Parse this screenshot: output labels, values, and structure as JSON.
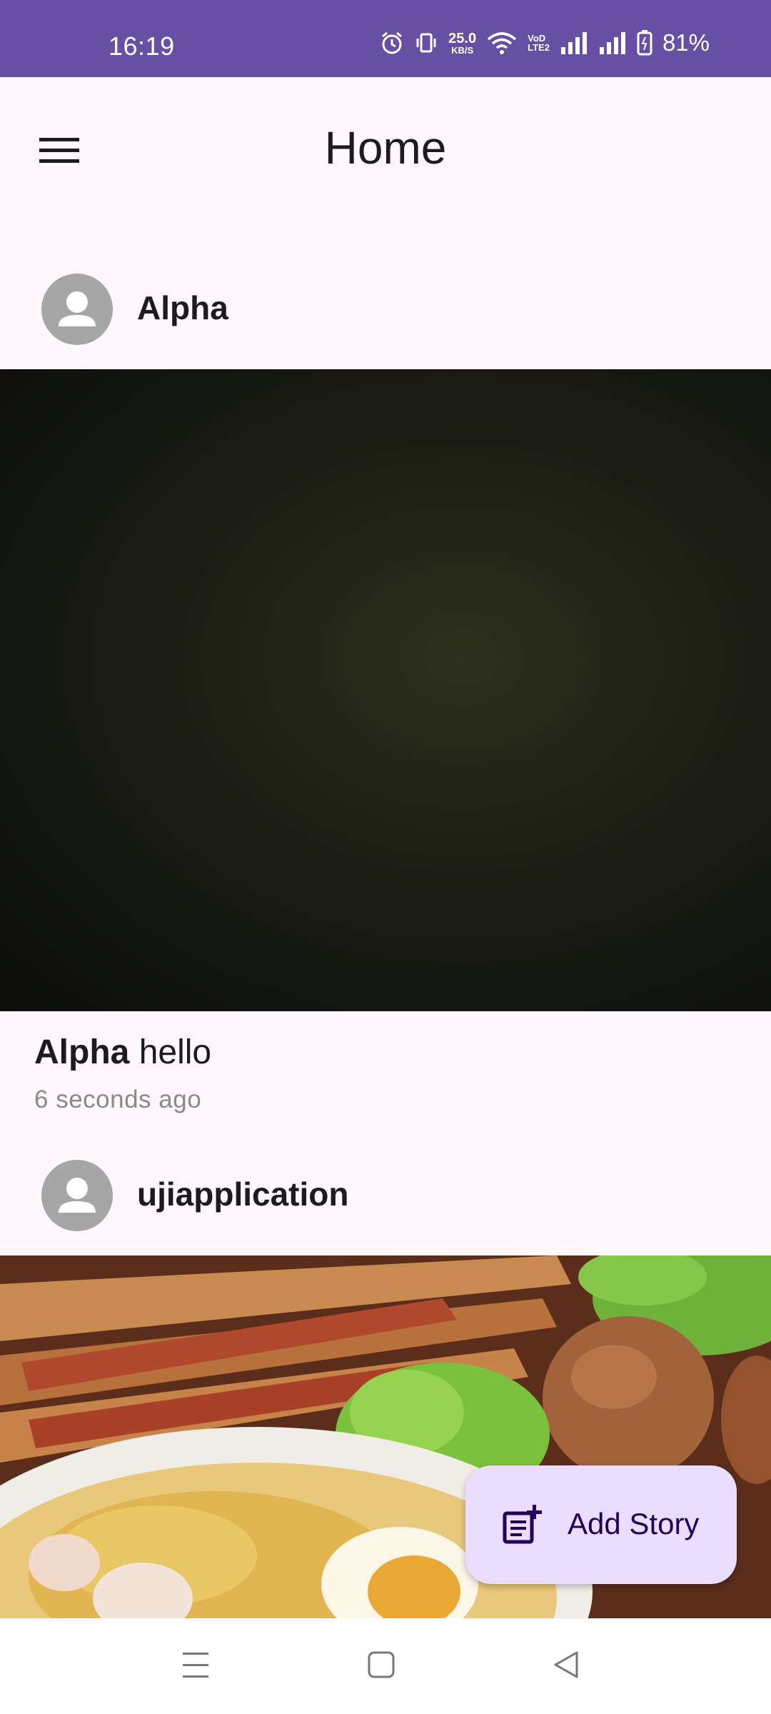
{
  "status_bar": {
    "time": "16:19",
    "net_speed_value": "25.0",
    "net_speed_unit": "KB/S",
    "volte_line1": "VoD",
    "volte_line2": "LTE2",
    "battery": "81%",
    "background_color": "#6750a4"
  },
  "app_bar": {
    "title": "Home",
    "menu_icon": "hamburger-menu-icon"
  },
  "feed": {
    "stories": [
      {
        "user": "Alpha",
        "caption_user": "Alpha",
        "caption_text": "hello",
        "time_ago": "6 seconds ago",
        "avatar_icon": "person-icon"
      },
      {
        "user": "ujiapplication",
        "avatar_icon": "person-icon"
      }
    ]
  },
  "fab": {
    "label": "Add Story",
    "icon": "post-add-icon",
    "background_color": "#eaddff"
  },
  "nav_bar": {
    "recents_icon": "recents-icon",
    "home_icon": "home-icon",
    "back_icon": "back-icon"
  }
}
